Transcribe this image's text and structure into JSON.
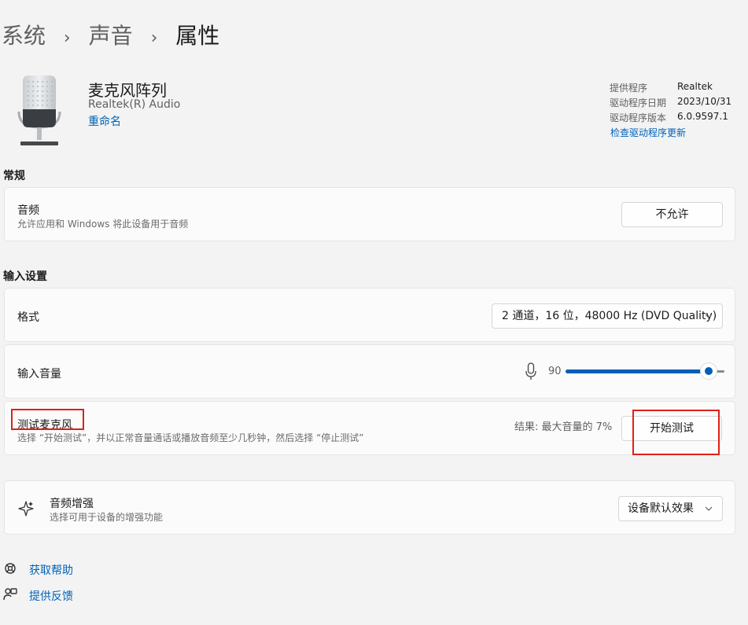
{
  "breadcrumb": {
    "level1": "系统",
    "level2": "声音",
    "current": "属性",
    "separator": "›"
  },
  "device": {
    "name": "麦克风阵列",
    "manufacturer": "Realtek(R) Audio",
    "rename_label": "重命名",
    "info": [
      {
        "label": "提供程序",
        "value": "Realtek"
      },
      {
        "label": "驱动程序日期",
        "value": "2023/10/31"
      },
      {
        "label": "驱动程序版本",
        "value": "6.0.9597.1"
      }
    ],
    "check_driver_label": "检查驱动程序更新"
  },
  "general": {
    "section_title": "常规",
    "audio_title": "音频",
    "audio_desc": "允许应用和 Windows 将此设备用于音频",
    "disallow_label": "不允许"
  },
  "input": {
    "section_title": "输入设置",
    "format_label": "格式",
    "format_value": "2 通道，16 位，48000 Hz (DVD Quality)",
    "volume_label": "输入音量",
    "volume_value": "90",
    "volume_level": 0.9,
    "test_title": "测试麦克风",
    "test_desc": "选择 “开始测试”，并以正常音量通话或播放音频至少几秒钟，然后选择 “停止测试”",
    "test_result": "结果: 最大音量的 7%",
    "start_test_label": "开始测试"
  },
  "enhance": {
    "title": "音频增强",
    "desc": "选择可用于设备的增强功能",
    "value": "设备默认效果"
  },
  "footer": {
    "help_label": "获取帮助",
    "feedback_label": "提供反馈"
  },
  "colors": {
    "accent": "#005fb8",
    "highlight": "#e0201a"
  }
}
